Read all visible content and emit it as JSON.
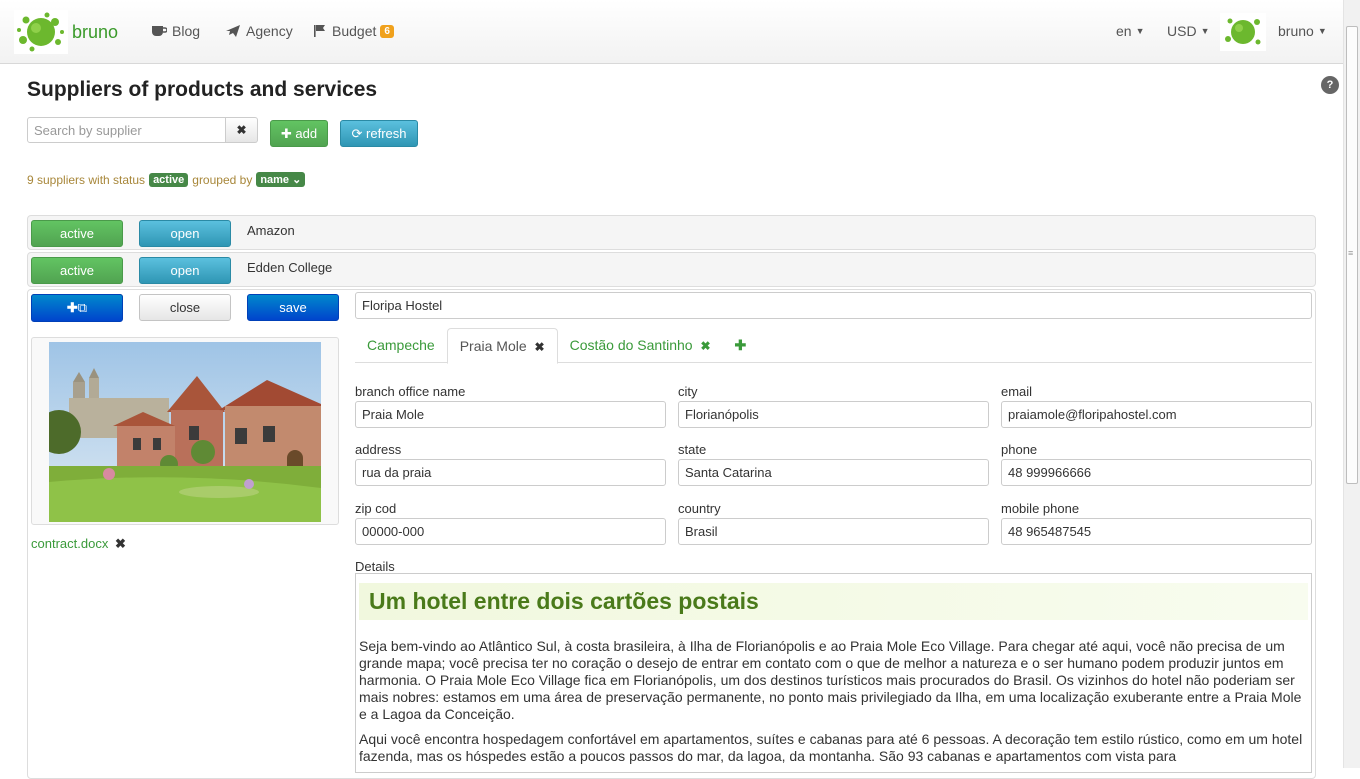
{
  "nav": {
    "brand": "bruno",
    "items": [
      {
        "label": "Blog",
        "icon": "coffee-cup-icon"
      },
      {
        "label": "Agency",
        "icon": "airplane-icon"
      },
      {
        "label": "Budget",
        "icon": "flag-icon",
        "badge": "6"
      }
    ],
    "language": "en",
    "currency": "USD",
    "user": "bruno"
  },
  "page": {
    "title": "Suppliers of products and services",
    "help": "?"
  },
  "toolbar": {
    "search_placeholder": "Search by supplier",
    "search_value": "",
    "add_label": "add",
    "refresh_label": "refresh"
  },
  "status": {
    "prefix": "9 suppliers with status",
    "status_value": "active",
    "middle": "grouped by",
    "group_value": "name"
  },
  "suppliers": [
    {
      "status": "active",
      "action": "open",
      "name": "Amazon"
    },
    {
      "status": "active",
      "action": "open",
      "name": "Edden College"
    },
    {
      "status": "active",
      "action": "close",
      "save": "save",
      "name": "Floripa Hostel"
    }
  ],
  "detail": {
    "attachment": "contract.docx",
    "tabs": [
      {
        "label": "Campeche",
        "closable": false,
        "active": false
      },
      {
        "label": "Praia Mole",
        "closable": true,
        "active": true
      },
      {
        "label": "Costão do Santinho",
        "closable": true,
        "active": false
      }
    ],
    "fields": {
      "branch_office_name": {
        "label": "branch office name",
        "value": "Praia Mole"
      },
      "city": {
        "label": "city",
        "value": "Florianópolis"
      },
      "email": {
        "label": "email",
        "value": "praiamole@floripahostel.com"
      },
      "address": {
        "label": "address",
        "value": "rua da praia"
      },
      "state": {
        "label": "state",
        "value": "Santa Catarina"
      },
      "phone": {
        "label": "phone",
        "value": "48 999966666"
      },
      "zip": {
        "label": "zip cod",
        "value": "00000-000"
      },
      "country": {
        "label": "country",
        "value": "Brasil"
      },
      "mobile": {
        "label": "mobile phone",
        "value": "48 965487545"
      }
    },
    "details_label": "Details",
    "editor": {
      "heading": "Um hotel entre dois cartões postais",
      "p1": "Seja bem-vindo ao Atlântico Sul, à costa brasileira, à Ilha de Florianópolis e ao Praia Mole Eco Village. Para chegar até aqui, você não precisa de um grande mapa; você precisa ter no coração o desejo de entrar em contato com o que de melhor a natureza e o ser humano podem produzir juntos em harmonia. O Praia Mole Eco Village fica em Florianópolis, um dos destinos turísticos mais procurados do Brasil. Os vizinhos do hotel não poderiam ser mais nobres: estamos em uma área de preservação permanente, no ponto mais privilegiado da Ilha, em uma localização exuberante entre a Praia Mole e a Lagoa da Conceição.",
      "p2": "Aqui você encontra hospedagem confortável em apartamentos, suítes e cabanas para até 6 pessoas. A decoração tem estilo rústico, como em um hotel fazenda, mas os hóspedes estão a poucos passos do mar, da lagoa, da montanha. São 93 cabanas e apartamentos com vista para"
    }
  },
  "colors": {
    "brand_green": "#3a9a2a",
    "btn_green": "#51a351",
    "btn_cyan": "#2f96b4",
    "btn_blue": "#0044cc",
    "status_text": "#a8873a",
    "label_green": "#468847",
    "heading_green": "#4a7a1a"
  }
}
